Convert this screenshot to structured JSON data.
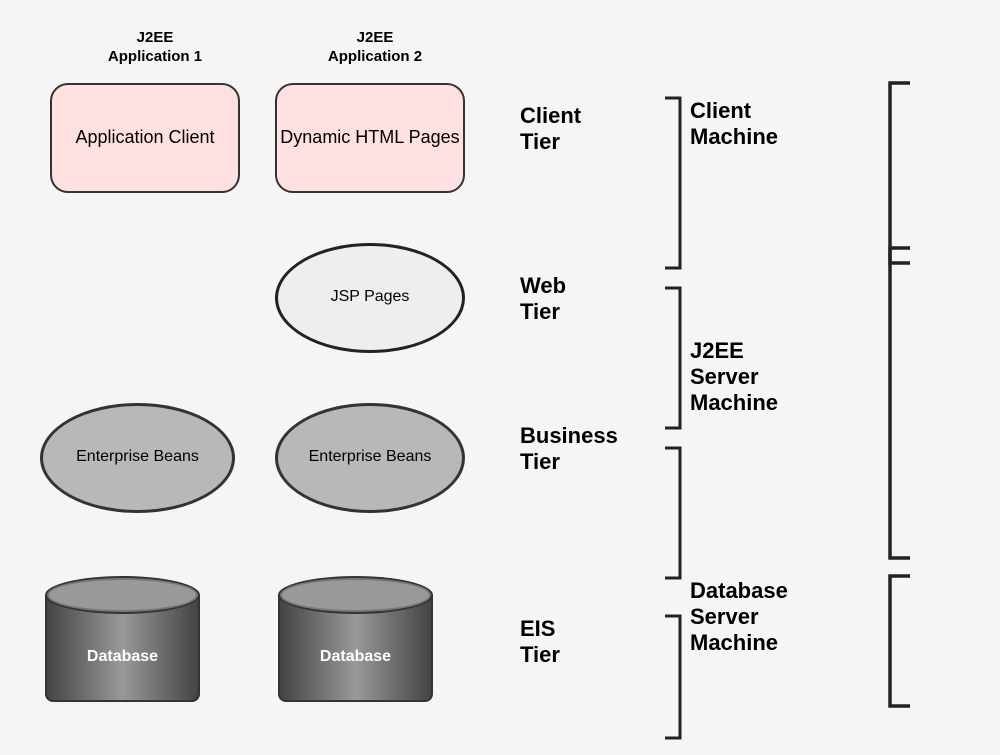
{
  "diagram": {
    "background": "white",
    "col1_header": "J2EE\nApplication 1",
    "col2_header": "J2EE\nApplication 2",
    "box1_label": "Application Client",
    "box2_label": "Dynamic HTML Pages",
    "ellipse1_label": "JSP Pages",
    "ellipse2_label": "Enterprise Beans",
    "ellipse3_label": "Enterprise Beans",
    "db1_label": "Database",
    "db2_label": "Database",
    "tier_client": "Client\nTier",
    "tier_web": "Web\nTier",
    "tier_business": "Business\nTier",
    "tier_eis": "EIS\nTier",
    "machine_client": "Client\nMachine",
    "machine_j2ee": "J2EE\nServer\nMachine",
    "machine_database": "Database\nServer\nMachine"
  }
}
